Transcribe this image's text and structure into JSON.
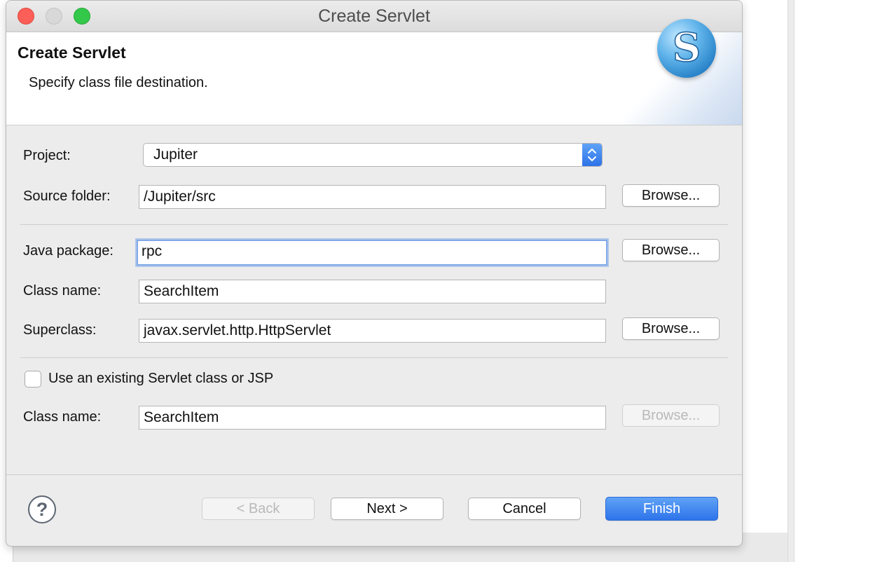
{
  "window": {
    "title": "Create Servlet"
  },
  "header": {
    "title": "Create Servlet",
    "subtitle": "Specify class file destination.",
    "logo_letter": "S"
  },
  "form": {
    "project_label": "Project:",
    "project_value": "Jupiter",
    "source_folder_label": "Source folder:",
    "source_folder_value": "/Jupiter/src",
    "java_package_label": "Java package:",
    "java_package_value": "rpc",
    "class_name_label": "Class name:",
    "class_name_value": "SearchItem",
    "superclass_label": "Superclass:",
    "superclass_value": "javax.servlet.http.HttpServlet",
    "use_existing_label": "Use an existing Servlet class or JSP",
    "existing_class_name_label": "Class name:",
    "existing_class_name_value": "SearchItem",
    "browse_label": "Browse..."
  },
  "footer": {
    "help_symbol": "?",
    "back_label": "< Back",
    "next_label": "Next >",
    "cancel_label": "Cancel",
    "finish_label": "Finish"
  },
  "colors": {
    "accent": "#2e74ea",
    "close": "#fc5f57",
    "zoom": "#34c84a"
  }
}
